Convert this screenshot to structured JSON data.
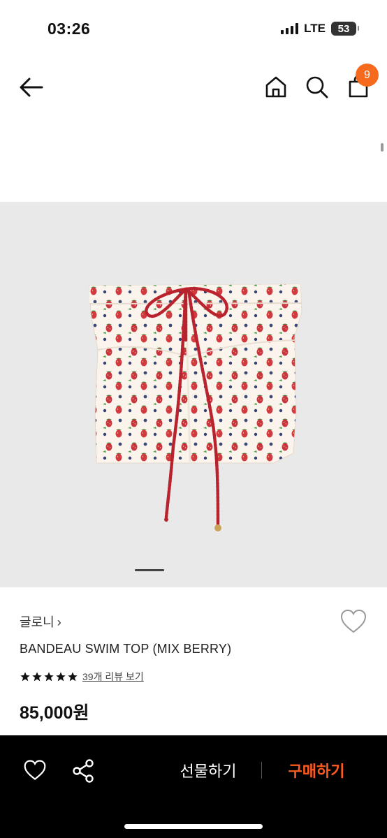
{
  "status": {
    "time": "03:26",
    "network": "LTE",
    "battery": "53"
  },
  "nav": {
    "cart_count": "9"
  },
  "product": {
    "brand": "글로니",
    "brand_chevron": "›",
    "name": "BANDEAU SWIM TOP (MIX BERRY)",
    "rating": 5,
    "review_link": "39개 리뷰 보기",
    "price": "85,000원"
  },
  "carousel": {
    "current": 1
  },
  "actions": {
    "gift_label": "선물하기",
    "buy_label": "구매하기"
  },
  "icons": {
    "back": "arrow-left-icon",
    "home": "home-icon",
    "search": "search-icon",
    "cart": "shopping-bag-icon",
    "wishlist": "heart-outline-icon",
    "share": "share-icon",
    "star": "star-filled-icon"
  },
  "colors": {
    "accent": "#f56a1c",
    "buy": "#ff5a1f",
    "bottom_bar": "#000000",
    "image_bg": "#e9e9e9"
  }
}
